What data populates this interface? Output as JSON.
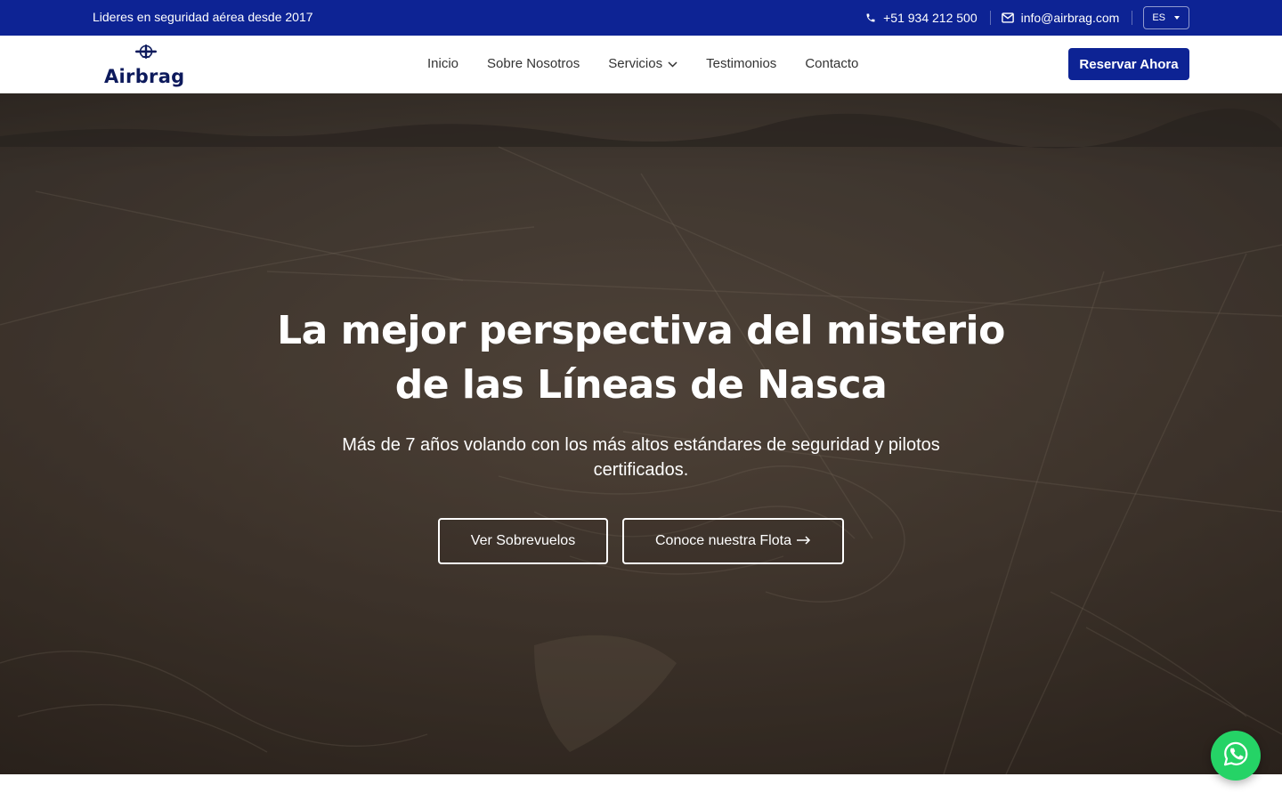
{
  "topbar": {
    "tagline": "Lideres en seguridad aérea desde 2017",
    "phone": "+51 934 212 500",
    "phone_icon": "phone-icon",
    "email": "info@airbrag.com",
    "email_icon": "mail-icon",
    "language": "ES",
    "background": "#0d2394"
  },
  "header": {
    "logo_text": "Airbrag",
    "logo_icon": "airplane-icon",
    "nav": {
      "inicio": "Inicio",
      "sobre": "Sobre Nosotros",
      "servicios": "Servicios",
      "testimonios": "Testimonios",
      "contacto": "Contacto"
    },
    "cta_label": "Reservar Ahora",
    "accent": "#0d2394"
  },
  "hero": {
    "title_line1": "La mejor perspectiva del misterio",
    "title_line2": "de las Líneas de Nasca",
    "subtitle": "Más de 7 años volando con los más altos estándares de seguridad y pilotos certificados.",
    "primary_label": "Ver Sobrevuelos",
    "secondary_label": "Conoce nuestra Flota",
    "secondary_icon": "arrow-right-icon"
  },
  "whatsapp": {
    "icon": "whatsapp-icon",
    "color": "#25d366"
  }
}
